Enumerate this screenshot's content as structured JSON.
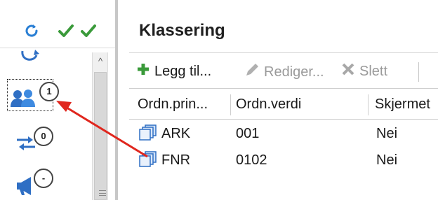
{
  "left_pane": {
    "top_icons": [
      "sync-icon",
      "checkmark-icon",
      "checkmark-icon"
    ],
    "nav_items": [
      {
        "icon": "flow-icon",
        "badge": ""
      },
      {
        "icon": "users-icon",
        "badge": "1"
      },
      {
        "icon": "transfer-arrows-icon",
        "badge": "0"
      },
      {
        "icon": "megaphone-icon",
        "badge": "-"
      }
    ],
    "scroll_up_glyph": "^"
  },
  "panel": {
    "title": "Klassering",
    "toolbar": {
      "add_label": "Legg til...",
      "edit_label": "Rediger...",
      "delete_label": "Slett"
    },
    "grid": {
      "columns": [
        "Ordn.prin...",
        "Ordn.verdi",
        "Skjermet"
      ],
      "rows": [
        {
          "principle": "ARK",
          "value": "001",
          "shielded": "Nei"
        },
        {
          "principle": "FNR",
          "value": "0102",
          "shielded": "Nei"
        }
      ]
    }
  },
  "colors": {
    "accent_green": "#3a9a3a",
    "sync_blue": "#2a7fd4",
    "icon_blue": "#2f6fc4",
    "arrow_red": "#e0261d"
  }
}
